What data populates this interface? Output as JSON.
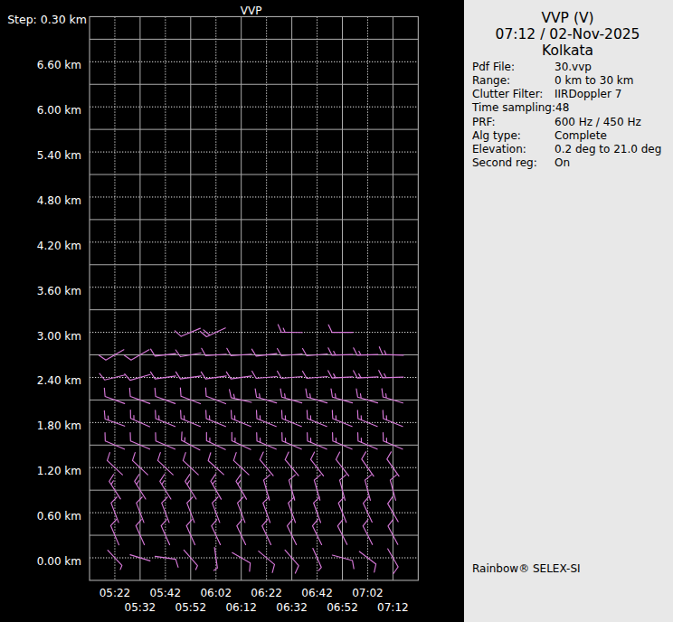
{
  "panel": {
    "title": "VVP (V)",
    "datetime": "07:12 / 02-Nov-2025",
    "site": "Kolkata",
    "params": [
      {
        "label": "Pdf File:",
        "value": "30.vvp"
      },
      {
        "label": "Range:",
        "value": "0 km to 30 km"
      },
      {
        "label": "Clutter Filter:",
        "value": "IIRDoppler 7"
      },
      {
        "label": "Time sampling:",
        "value": "48"
      },
      {
        "label": "PRF:",
        "value": "600 Hz / 450 Hz"
      },
      {
        "label": "Alg type:",
        "value": "Complete"
      },
      {
        "label": "Elevation:",
        "value": "0.2 deg to 21.0 deg"
      },
      {
        "label": "Second reg:",
        "value": "On"
      }
    ],
    "footer": "Rainbow® SELEX-SI",
    "bg_color": "#e8e8e8",
    "text_color": "#000000"
  },
  "chart_data": {
    "type": "wind_barb_time_height",
    "title": "VVP",
    "step_label": "Step: 0.30 km",
    "x_axis": {
      "labels": [
        "05:22",
        "05:32",
        "05:42",
        "05:52",
        "06:02",
        "06:12",
        "06:22",
        "06:32",
        "06:42",
        "06:52",
        "07:02",
        "07:12"
      ],
      "range": [
        "05:12",
        "07:22"
      ],
      "tick_interval_min": 10
    },
    "y_axis": {
      "unit": "km",
      "labels": [
        "0.00 km",
        "0.60 km",
        "1.20 km",
        "1.80 km",
        "2.40 km",
        "3.00 km",
        "3.60 km",
        "4.20 km",
        "4.80 km",
        "5.40 km",
        "6.00 km",
        "6.60 km"
      ],
      "label_step_km": 0.6,
      "grid_step_km": 0.3,
      "range_km": [
        -0.3,
        7.2
      ]
    },
    "colors": {
      "background": "#000000",
      "grid_solid": "#ababab",
      "grid_dotted": "#e2e2e2",
      "text": "#ffffff",
      "barb": "#d678d8"
    },
    "barb_units": "kt",
    "barbs": [
      {
        "t": "05:52",
        "h": 3.0,
        "dir": 247,
        "spd": 10
      },
      {
        "t": "06:02",
        "h": 3.0,
        "dir": 245,
        "spd": 20
      },
      {
        "t": "06:32",
        "h": 3.0,
        "dir": 271,
        "spd": 15
      },
      {
        "t": "06:52",
        "h": 3.0,
        "dir": 270,
        "spd": 10
      },
      {
        "t": "05:22",
        "h": 2.7,
        "dir": 240,
        "spd": 10
      },
      {
        "t": "05:32",
        "h": 2.7,
        "dir": 240,
        "spd": 10
      },
      {
        "t": "05:42",
        "h": 2.7,
        "dir": 263,
        "spd": 10
      },
      {
        "t": "05:52",
        "h": 2.7,
        "dir": 260,
        "spd": 10
      },
      {
        "t": "06:02",
        "h": 2.7,
        "dir": 266,
        "spd": 10
      },
      {
        "t": "06:12",
        "h": 2.7,
        "dir": 266,
        "spd": 10
      },
      {
        "t": "06:22",
        "h": 2.7,
        "dir": 263,
        "spd": 10
      },
      {
        "t": "06:32",
        "h": 2.7,
        "dir": 265,
        "spd": 10
      },
      {
        "t": "06:42",
        "h": 2.7,
        "dir": 265,
        "spd": 10
      },
      {
        "t": "06:52",
        "h": 2.7,
        "dir": 268,
        "spd": 15
      },
      {
        "t": "07:02",
        "h": 2.7,
        "dir": 268,
        "spd": 15
      },
      {
        "t": "07:12",
        "h": 2.7,
        "dir": 272,
        "spd": 15
      },
      {
        "t": "05:22",
        "h": 2.4,
        "dir": 256,
        "spd": 10
      },
      {
        "t": "05:32",
        "h": 2.4,
        "dir": 254,
        "spd": 10
      },
      {
        "t": "05:42",
        "h": 2.4,
        "dir": 262,
        "spd": 10
      },
      {
        "t": "05:52",
        "h": 2.4,
        "dir": 262,
        "spd": 10
      },
      {
        "t": "06:02",
        "h": 2.4,
        "dir": 262,
        "spd": 10
      },
      {
        "t": "06:12",
        "h": 2.4,
        "dir": 262,
        "spd": 10
      },
      {
        "t": "06:22",
        "h": 2.4,
        "dir": 265,
        "spd": 10
      },
      {
        "t": "06:32",
        "h": 2.4,
        "dir": 265,
        "spd": 10
      },
      {
        "t": "06:42",
        "h": 2.4,
        "dir": 265,
        "spd": 10
      },
      {
        "t": "06:52",
        "h": 2.4,
        "dir": 267,
        "spd": 15
      },
      {
        "t": "07:02",
        "h": 2.4,
        "dir": 267,
        "spd": 15
      },
      {
        "t": "07:12",
        "h": 2.4,
        "dir": 268,
        "spd": 15
      },
      {
        "t": "05:22",
        "h": 2.1,
        "dir": 290,
        "spd": 10
      },
      {
        "t": "05:32",
        "h": 2.1,
        "dir": 290,
        "spd": 10
      },
      {
        "t": "05:42",
        "h": 2.1,
        "dir": 290,
        "spd": 10
      },
      {
        "t": "05:52",
        "h": 2.1,
        "dir": 291,
        "spd": 10
      },
      {
        "t": "06:02",
        "h": 2.1,
        "dir": 291,
        "spd": 10
      },
      {
        "t": "06:12",
        "h": 2.1,
        "dir": 283,
        "spd": 15
      },
      {
        "t": "06:22",
        "h": 2.1,
        "dir": 286,
        "spd": 15
      },
      {
        "t": "06:32",
        "h": 2.1,
        "dir": 286,
        "spd": 15
      },
      {
        "t": "06:42",
        "h": 2.1,
        "dir": 286,
        "spd": 15
      },
      {
        "t": "06:52",
        "h": 2.1,
        "dir": 286,
        "spd": 15
      },
      {
        "t": "07:02",
        "h": 2.1,
        "dir": 286,
        "spd": 15
      },
      {
        "t": "07:12",
        "h": 2.1,
        "dir": 287,
        "spd": 15
      },
      {
        "t": "05:22",
        "h": 1.8,
        "dir": 290,
        "spd": 15
      },
      {
        "t": "05:32",
        "h": 1.8,
        "dir": 294,
        "spd": 15
      },
      {
        "t": "05:42",
        "h": 1.8,
        "dir": 292,
        "spd": 15
      },
      {
        "t": "05:52",
        "h": 1.8,
        "dir": 292,
        "spd": 15
      },
      {
        "t": "06:02",
        "h": 1.8,
        "dir": 292,
        "spd": 15
      },
      {
        "t": "06:12",
        "h": 1.8,
        "dir": 292,
        "spd": 15
      },
      {
        "t": "06:22",
        "h": 1.8,
        "dir": 292,
        "spd": 15
      },
      {
        "t": "06:32",
        "h": 1.8,
        "dir": 292,
        "spd": 15
      },
      {
        "t": "06:42",
        "h": 1.8,
        "dir": 292,
        "spd": 15
      },
      {
        "t": "06:52",
        "h": 1.8,
        "dir": 292,
        "spd": 15
      },
      {
        "t": "07:02",
        "h": 1.8,
        "dir": 292,
        "spd": 15
      },
      {
        "t": "07:12",
        "h": 1.8,
        "dir": 292,
        "spd": 15
      },
      {
        "t": "05:22",
        "h": 1.5,
        "dir": 293,
        "spd": 10
      },
      {
        "t": "05:32",
        "h": 1.5,
        "dir": 293,
        "spd": 10
      },
      {
        "t": "05:42",
        "h": 1.5,
        "dir": 293,
        "spd": 10
      },
      {
        "t": "05:52",
        "h": 1.5,
        "dir": 298,
        "spd": 15
      },
      {
        "t": "06:02",
        "h": 1.5,
        "dir": 295,
        "spd": 15
      },
      {
        "t": "06:12",
        "h": 1.5,
        "dir": 295,
        "spd": 15
      },
      {
        "t": "06:22",
        "h": 1.5,
        "dir": 293,
        "spd": 15
      },
      {
        "t": "06:32",
        "h": 1.5,
        "dir": 293,
        "spd": 15
      },
      {
        "t": "06:42",
        "h": 1.5,
        "dir": 293,
        "spd": 15
      },
      {
        "t": "06:52",
        "h": 1.5,
        "dir": 293,
        "spd": 15
      },
      {
        "t": "07:02",
        "h": 1.5,
        "dir": 293,
        "spd": 15
      },
      {
        "t": "07:12",
        "h": 1.5,
        "dir": 293,
        "spd": 15
      },
      {
        "t": "05:22",
        "h": 1.2,
        "dir": 313,
        "spd": 10
      },
      {
        "t": "05:32",
        "h": 1.2,
        "dir": 313,
        "spd": 10
      },
      {
        "t": "05:42",
        "h": 1.2,
        "dir": 313,
        "spd": 10
      },
      {
        "t": "05:52",
        "h": 1.2,
        "dir": 313,
        "spd": 10
      },
      {
        "t": "06:02",
        "h": 1.2,
        "dir": 312,
        "spd": 10
      },
      {
        "t": "06:12",
        "h": 1.2,
        "dir": 313,
        "spd": 10
      },
      {
        "t": "06:22",
        "h": 1.2,
        "dir": 320,
        "spd": 10
      },
      {
        "t": "06:32",
        "h": 1.2,
        "dir": 320,
        "spd": 10
      },
      {
        "t": "06:42",
        "h": 1.2,
        "dir": 322,
        "spd": 10
      },
      {
        "t": "06:52",
        "h": 1.2,
        "dir": 322,
        "spd": 10
      },
      {
        "t": "07:02",
        "h": 1.2,
        "dir": 325,
        "spd": 10
      },
      {
        "t": "07:12",
        "h": 1.2,
        "dir": 325,
        "spd": 10
      },
      {
        "t": "05:22",
        "h": 0.9,
        "dir": 327,
        "spd": 15
      },
      {
        "t": "05:32",
        "h": 0.9,
        "dir": 328,
        "spd": 15
      },
      {
        "t": "05:42",
        "h": 0.9,
        "dir": 328,
        "spd": 15
      },
      {
        "t": "05:52",
        "h": 0.9,
        "dir": 328,
        "spd": 15
      },
      {
        "t": "06:02",
        "h": 0.9,
        "dir": 330,
        "spd": 15
      },
      {
        "t": "06:12",
        "h": 0.9,
        "dir": 330,
        "spd": 15
      },
      {
        "t": "06:22",
        "h": 0.9,
        "dir": 344,
        "spd": 10
      },
      {
        "t": "06:32",
        "h": 0.9,
        "dir": 344,
        "spd": 10
      },
      {
        "t": "06:42",
        "h": 0.9,
        "dir": 344,
        "spd": 10
      },
      {
        "t": "06:52",
        "h": 0.9,
        "dir": 345,
        "spd": 10
      },
      {
        "t": "07:02",
        "h": 0.9,
        "dir": 345,
        "spd": 10
      },
      {
        "t": "07:12",
        "h": 0.9,
        "dir": 345,
        "spd": 10
      },
      {
        "t": "05:22",
        "h": 0.6,
        "dir": 339,
        "spd": 10
      },
      {
        "t": "05:32",
        "h": 0.6,
        "dir": 339,
        "spd": 10
      },
      {
        "t": "05:42",
        "h": 0.6,
        "dir": 339,
        "spd": 10
      },
      {
        "t": "05:52",
        "h": 0.6,
        "dir": 339,
        "spd": 10
      },
      {
        "t": "06:02",
        "h": 0.6,
        "dir": 339,
        "spd": 10
      },
      {
        "t": "06:12",
        "h": 0.6,
        "dir": 339,
        "spd": 10
      },
      {
        "t": "06:22",
        "h": 0.6,
        "dir": 340,
        "spd": 10
      },
      {
        "t": "06:32",
        "h": 0.6,
        "dir": 340,
        "spd": 10
      },
      {
        "t": "06:42",
        "h": 0.6,
        "dir": 340,
        "spd": 10
      },
      {
        "t": "06:52",
        "h": 0.6,
        "dir": 338,
        "spd": 10
      },
      {
        "t": "07:02",
        "h": 0.6,
        "dir": 335,
        "spd": 10
      },
      {
        "t": "07:12",
        "h": 0.6,
        "dir": 330,
        "spd": 10
      },
      {
        "t": "05:22",
        "h": 0.3,
        "dir": 337,
        "spd": 10
      },
      {
        "t": "05:32",
        "h": 0.3,
        "dir": 336,
        "spd": 10
      },
      {
        "t": "05:42",
        "h": 0.3,
        "dir": 336,
        "spd": 10
      },
      {
        "t": "05:52",
        "h": 0.3,
        "dir": 336,
        "spd": 10
      },
      {
        "t": "06:02",
        "h": 0.3,
        "dir": 335,
        "spd": 10
      },
      {
        "t": "06:12",
        "h": 0.3,
        "dir": 335,
        "spd": 10
      },
      {
        "t": "06:22",
        "h": 0.3,
        "dir": 335,
        "spd": 10
      },
      {
        "t": "06:32",
        "h": 0.3,
        "dir": 334,
        "spd": 10
      },
      {
        "t": "06:42",
        "h": 0.3,
        "dir": 334,
        "spd": 10
      },
      {
        "t": "06:52",
        "h": 0.3,
        "dir": 333,
        "spd": 10
      },
      {
        "t": "07:02",
        "h": 0.3,
        "dir": 333,
        "spd": 10
      },
      {
        "t": "07:12",
        "h": 0.3,
        "dir": 332,
        "spd": 10
      },
      {
        "t": "05:22",
        "h": 0.0,
        "dir": 137,
        "spd": 5
      },
      {
        "t": "05:32",
        "h": 0.0,
        "dir": 287,
        "spd": 0
      },
      {
        "t": "05:42",
        "h": 0.0,
        "dir": 98,
        "spd": 10
      },
      {
        "t": "05:52",
        "h": 0.0,
        "dir": 139,
        "spd": 5
      },
      {
        "t": "06:02",
        "h": 0.0,
        "dir": 172,
        "spd": 5
      },
      {
        "t": "06:12",
        "h": 0.0,
        "dir": 120,
        "spd": 10
      },
      {
        "t": "06:22",
        "h": 0.0,
        "dir": 130,
        "spd": 10
      },
      {
        "t": "06:32",
        "h": 0.0,
        "dir": 139,
        "spd": 10
      },
      {
        "t": "06:42",
        "h": 0.0,
        "dir": 156,
        "spd": 5
      },
      {
        "t": "06:52",
        "h": 0.0,
        "dir": 105,
        "spd": 10
      },
      {
        "t": "07:02",
        "h": 0.0,
        "dir": 127,
        "spd": 10
      },
      {
        "t": "07:12",
        "h": 0.0,
        "dir": 150,
        "spd": 10
      }
    ]
  }
}
